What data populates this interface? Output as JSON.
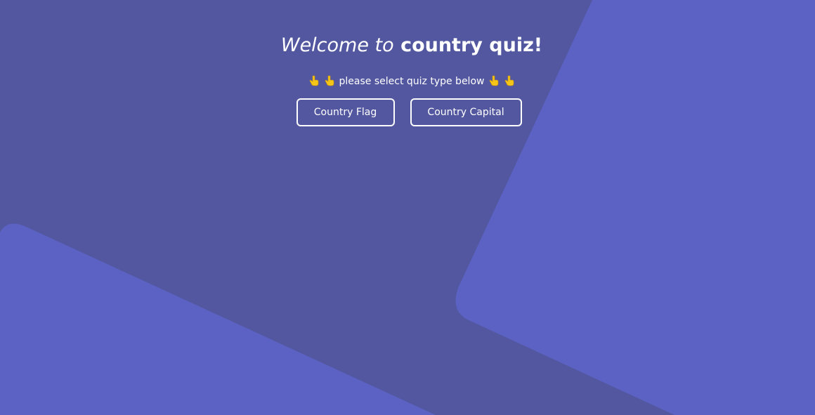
{
  "theme": {
    "background": "#5257a0",
    "shape_color": "#5c62c3",
    "text_color": "#ffffff",
    "emoji_color": "#f5c518"
  },
  "header": {
    "welcome_text": "Welcome to",
    "brand_text": "country quiz!"
  },
  "prompt": {
    "text": "please select quiz type below",
    "left_icons": [
      "pointing-down-hand-icon",
      "pointing-down-hand-icon"
    ],
    "right_icons": [
      "pointing-down-hand-icon",
      "pointing-down-hand-icon"
    ]
  },
  "quiz_types": {
    "flag_label": "Country Flag",
    "capital_label": "Country Capital"
  }
}
